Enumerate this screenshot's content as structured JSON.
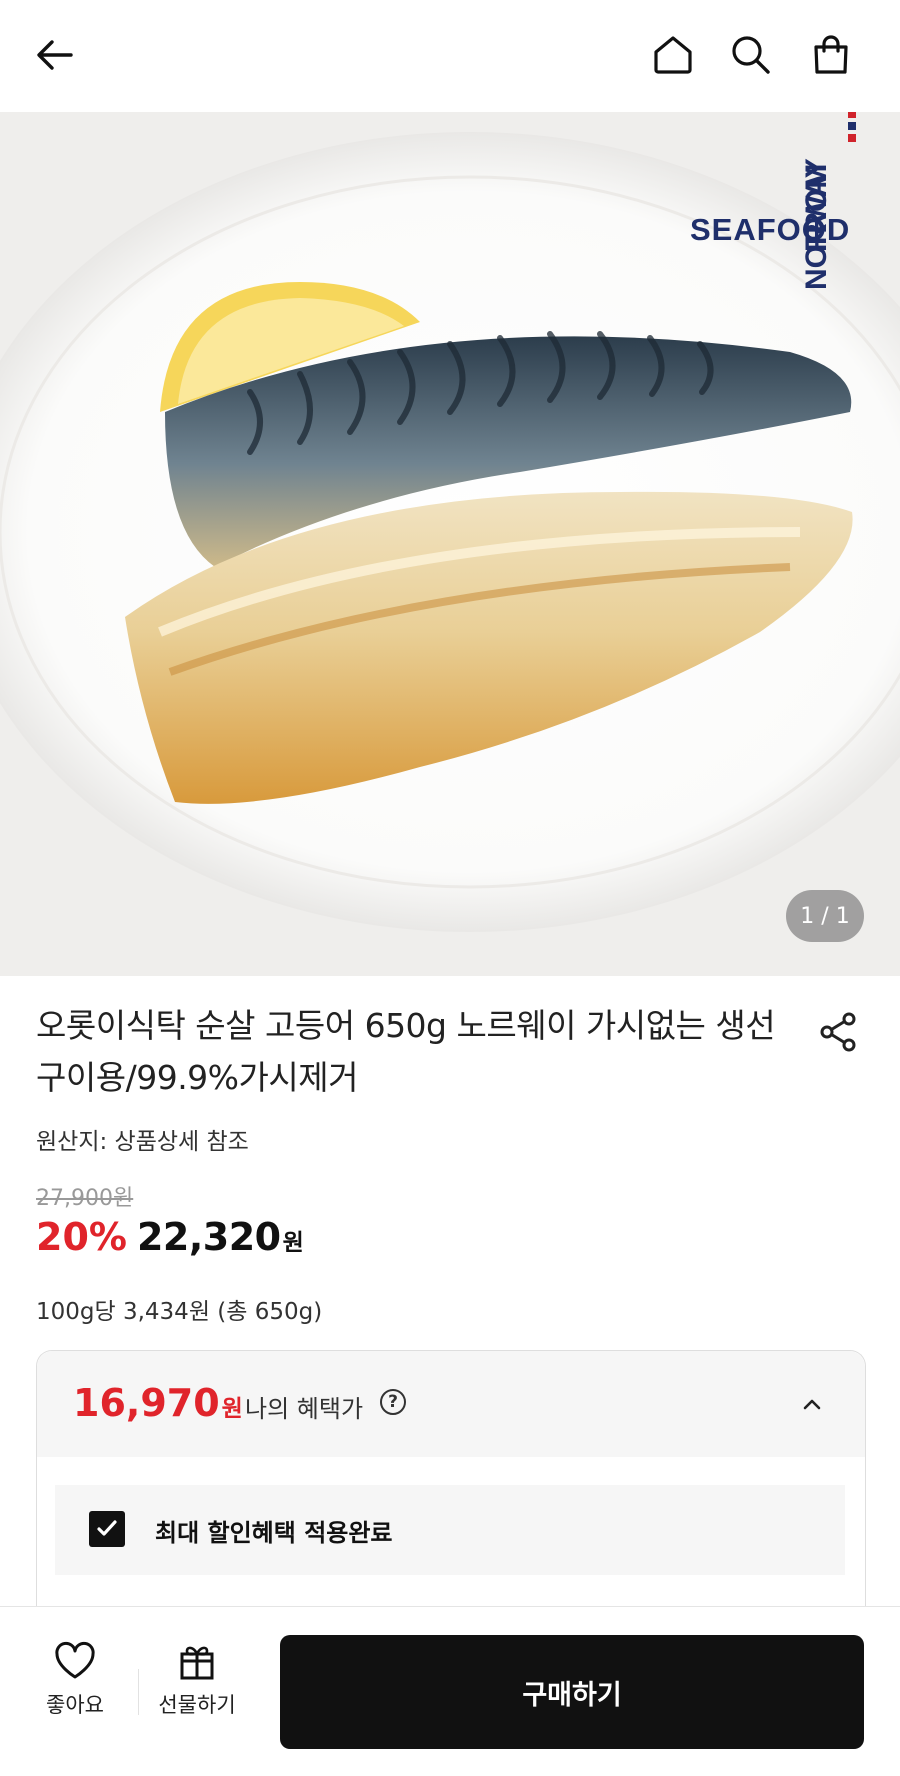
{
  "header": {
    "icons": [
      "back-arrow-icon",
      "home-icon",
      "search-icon",
      "shopping-bag-icon"
    ]
  },
  "hero": {
    "counter": "1 / 1",
    "brand_logo": [
      "FROM",
      "NORWAY",
      "SEAFOOD"
    ]
  },
  "product": {
    "title": "오롯이식탁 순살 고등어 650g 노르웨이 가시없는 생선 구이용/99.9%가시제거",
    "origin": "원산지: 상품상세 참조",
    "original_price": "27,900원",
    "discount": "20%",
    "price": "22,320",
    "price_unit": "원",
    "unit_price": "100g당 3,434원 (총 650g)"
  },
  "benefit": {
    "price": "16,970",
    "price_unit": "원",
    "label": "나의 혜택가",
    "help": "?",
    "applied_text": "최대 할인혜택 적용완료"
  },
  "bottom_bar": {
    "like_label": "좋아요",
    "gift_label": "선물하기",
    "buy_label": "구매하기"
  },
  "colors": {
    "accent_red": "#e0242b",
    "buy_button": "#111111",
    "brand_navy": "#1f2f6b"
  }
}
